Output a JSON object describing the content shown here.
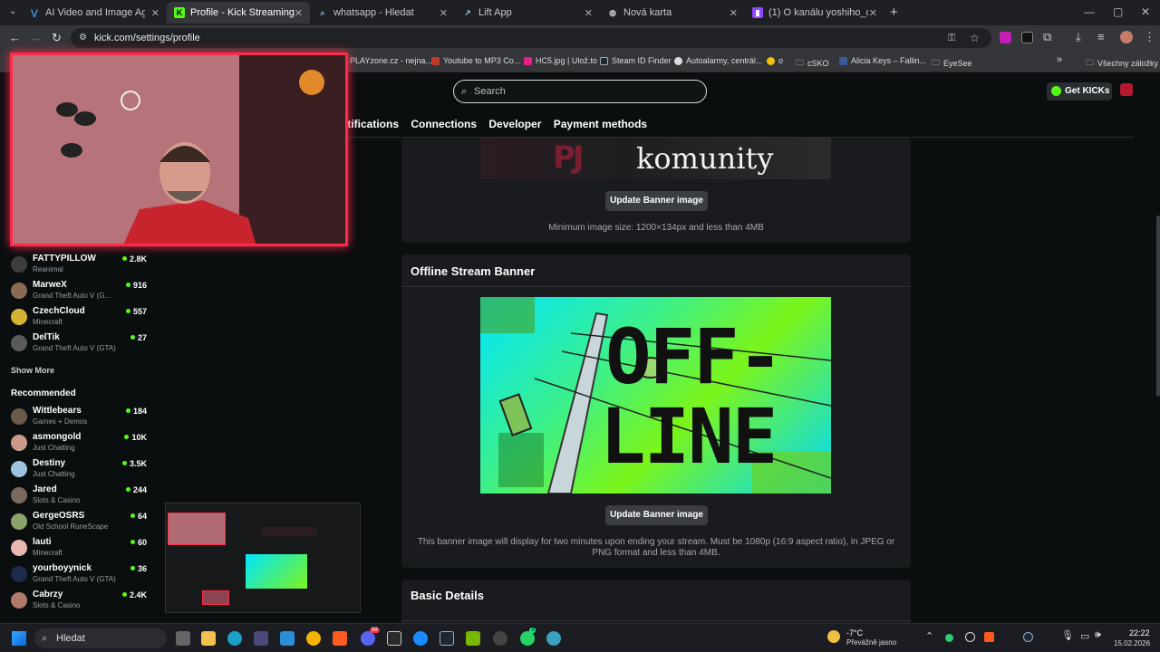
{
  "browser": {
    "tabs": [
      {
        "title": "AI Video and Image Agent: Aut",
        "active": false
      },
      {
        "title": "Profile - Kick Streaming",
        "active": true
      },
      {
        "title": "whatsapp - Hledat",
        "active": false
      },
      {
        "title": "Lift App",
        "active": false
      },
      {
        "title": "Nová karta",
        "active": false
      },
      {
        "title": "(1) O kanálu yoshiho_denicek -",
        "active": false
      }
    ],
    "url": "kick.com/settings/profile",
    "bookmarks": [
      "PLAYzone.cz - nejna...",
      "Youtube to MP3 Co...",
      "HC5.jpg | Ulož.to",
      "Steam ID Finder",
      "Autoalarmy, centrál...",
      "o",
      "cSKO",
      "Alicia Keys – Fallin...",
      "EyeSee",
      "Všechny záložky"
    ]
  },
  "header": {
    "search_placeholder": "Search",
    "get_kicks": "Get KICKs"
  },
  "settings_tabs": [
    "otifications",
    "Connections",
    "Developer",
    "Payment methods"
  ],
  "profile_banner": {
    "banner_text": "komunity",
    "button": "Update Banner image",
    "hint": "Minimum image size: 1200×134px and less than 4MB"
  },
  "offline_banner": {
    "title": "Offline Stream Banner",
    "image_text_line1": "OFF-",
    "image_text_line2": "LINE",
    "button": "Update Banner image",
    "hint_line1": "This banner image will display for two minutes upon ending your stream. Must be 1080p (16:9 aspect ratio), in JPEG or",
    "hint_line2": "PNG format and less than 4MB."
  },
  "basic_details": {
    "title": "Basic Details"
  },
  "sidebar": {
    "following": [
      {
        "name": "FATTYPILLOW",
        "game": "Reanimal",
        "viewers": "2.8K"
      },
      {
        "name": "MarweX",
        "game": "Grand Theft Auto V (G...",
        "viewers": "916"
      },
      {
        "name": "CzechCloud",
        "game": "Minecraft",
        "viewers": "557"
      },
      {
        "name": "DelTik",
        "game": "Grand Theft Auto V (GTA)",
        "viewers": "27"
      }
    ],
    "show_more": "Show More",
    "recommended_title": "Recommended",
    "recommended": [
      {
        "name": "Wittlebears",
        "game": "Games + Demos",
        "viewers": "184"
      },
      {
        "name": "asmongold",
        "game": "Just Chatting",
        "viewers": "10K"
      },
      {
        "name": "Destiny",
        "game": "Just Chatting",
        "viewers": "3.5K"
      },
      {
        "name": "Jared",
        "game": "Slots & Casino",
        "viewers": "244"
      },
      {
        "name": "GergeOSRS",
        "game": "Old School RuneScape",
        "viewers": "64"
      },
      {
        "name": "lauti",
        "game": "Minecraft",
        "viewers": "60"
      },
      {
        "name": "yourboyynick",
        "game": "Grand Theft Auto V (GTA)",
        "viewers": "36"
      },
      {
        "name": "Cabrzy",
        "game": "Slots & Casino",
        "viewers": "2.4K"
      }
    ]
  },
  "taskbar": {
    "search": "Hledat",
    "weather_temp": "-7°C",
    "weather_desc": "Převážně jasno",
    "time": "22:22",
    "date": "15.02.2026",
    "discord_badge": "99",
    "whatsapp_badge": "3"
  },
  "colors": {
    "kick_green": "#53fc18",
    "panel_bg": "#191b1f",
    "page_bg": "#0b0e0f",
    "webcam_border": "#ff2a4a"
  }
}
